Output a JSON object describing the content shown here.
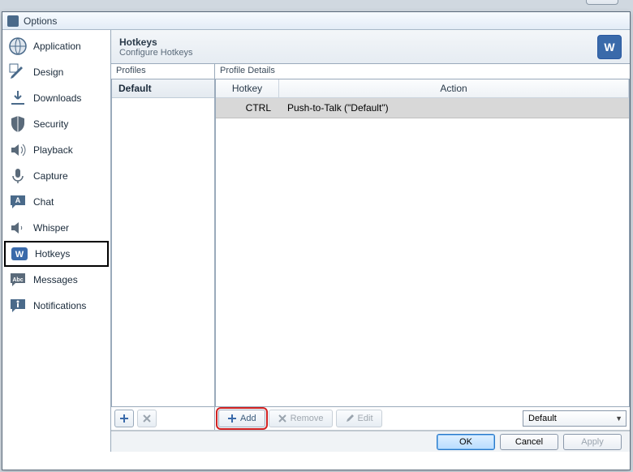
{
  "window": {
    "title": "Options",
    "close_glyph": "✕"
  },
  "sidebar": {
    "items": [
      {
        "label": "Application"
      },
      {
        "label": "Design"
      },
      {
        "label": "Downloads"
      },
      {
        "label": "Security"
      },
      {
        "label": "Playback"
      },
      {
        "label": "Capture"
      },
      {
        "label": "Chat"
      },
      {
        "label": "Whisper"
      },
      {
        "label": "Hotkeys"
      },
      {
        "label": "Messages"
      },
      {
        "label": "Notifications"
      }
    ],
    "selected_index": 8
  },
  "header": {
    "title": "Hotkeys",
    "subtitle": "Configure Hotkeys",
    "badge": "W"
  },
  "profiles": {
    "label": "Profiles",
    "rows": [
      {
        "name": "Default"
      }
    ],
    "toolbar": {
      "add": "+",
      "remove": "✕"
    }
  },
  "details": {
    "label": "Profile Details",
    "columns": {
      "hotkey": "Hotkey",
      "action": "Action"
    },
    "rows": [
      {
        "hotkey": "CTRL",
        "action": "Push-to-Talk (\"Default\")"
      }
    ],
    "toolbar": {
      "add": "Add",
      "remove": "Remove",
      "edit": "Edit",
      "dropdown_value": "Default"
    }
  },
  "footer": {
    "ok": "OK",
    "cancel": "Cancel",
    "apply": "Apply"
  }
}
